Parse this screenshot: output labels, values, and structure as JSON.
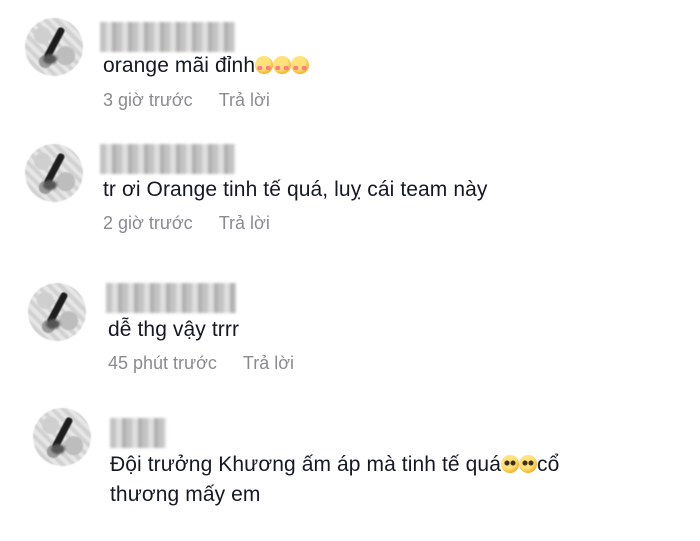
{
  "comments": [
    {
      "text": "orange mãi đỉnh",
      "emojis": [
        "smiling-face-with-hearts",
        "smiling-face-with-hearts",
        "smiling-face-with-hearts"
      ],
      "time": "3 giờ trước",
      "reply": "Trả lời"
    },
    {
      "text": "tr ơi Orange tinh tế quá, luỵ cái team này",
      "time": "2 giờ trước",
      "reply": "Trả lời"
    },
    {
      "text": "dễ thg vậy trrr",
      "time": "45 phút trước",
      "reply": "Trả lời"
    },
    {
      "text_line1_before": "Đội trưởng Khương ấm áp mà tinh tế quá",
      "emojis": [
        "pleading-face",
        "pleading-face"
      ],
      "text_line1_after": "cổ",
      "text_line2": "thương mấy em"
    }
  ]
}
